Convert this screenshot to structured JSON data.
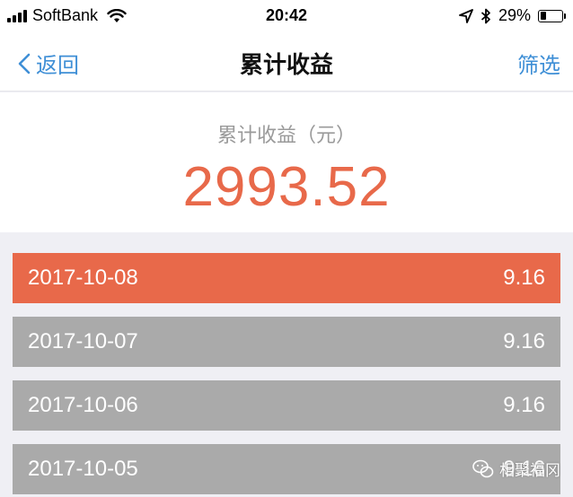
{
  "status_bar": {
    "carrier": "SoftBank",
    "time": "20:42",
    "battery_percent": "29%",
    "battery_level": 0.29,
    "icons": [
      "signal-icon",
      "wifi-icon",
      "location-arrow-icon",
      "bluetooth-icon",
      "battery-icon"
    ]
  },
  "nav": {
    "back_label": "返回",
    "title": "累计收益",
    "filter_label": "筛选",
    "accent_color": "#3f8fd6"
  },
  "summary": {
    "label": "累计收益（元）",
    "value": "2993.52",
    "value_color": "#e8694a"
  },
  "rows": [
    {
      "date": "2017-10-08",
      "amount": "9.16",
      "selected": true
    },
    {
      "date": "2017-10-07",
      "amount": "9.16",
      "selected": false
    },
    {
      "date": "2017-10-06",
      "amount": "9.16",
      "selected": false
    },
    {
      "date": "2017-10-05",
      "amount": "9.16",
      "selected": false
    }
  ],
  "colors": {
    "selected_row": "#e8694a",
    "row": "#aaaaaa",
    "page_background": "#efeff4"
  },
  "watermark": {
    "text": "相聚福冈",
    "icon": "wechat-icon"
  }
}
